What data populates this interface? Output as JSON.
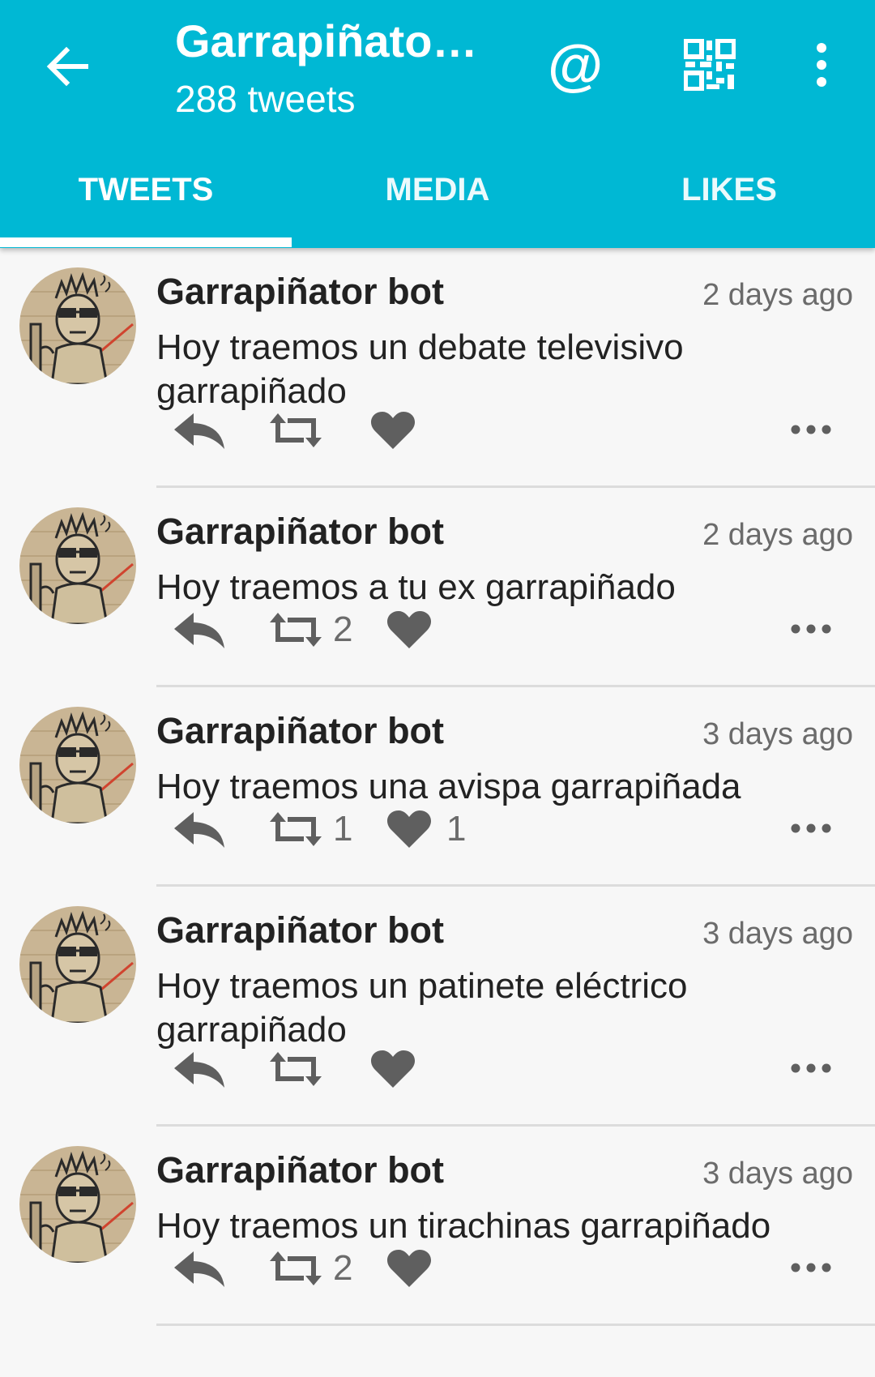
{
  "header": {
    "back_icon": "arrow-left-icon",
    "title": "Garrapiñator…",
    "subtitle": "288 tweets",
    "mention_glyph": "@",
    "qr_icon": "qr-code-icon",
    "more_icon": "vertical-dots-icon"
  },
  "tabs": [
    {
      "label": "TWEETS",
      "active": true
    },
    {
      "label": "MEDIA",
      "active": false
    },
    {
      "label": "LIKES",
      "active": false
    }
  ],
  "colors": {
    "accent": "#00b8d4",
    "background": "#f7f7f7",
    "text": "#222222",
    "muted": "#6b6b6b",
    "icon": "#5f5f5f"
  },
  "tweets": [
    {
      "author": "Garrapiñator bot",
      "time": "2 days ago",
      "text": "Hoy traemos un debate televisivo garrapiñado",
      "retweets": "",
      "likes": ""
    },
    {
      "author": "Garrapiñator bot",
      "time": "2 days ago",
      "text": "Hoy traemos a tu ex garrapiñado",
      "retweets": "2",
      "likes": ""
    },
    {
      "author": "Garrapiñator bot",
      "time": "3 days ago",
      "text": "Hoy traemos una avispa garrapiñada",
      "retweets": "1",
      "likes": "1"
    },
    {
      "author": "Garrapiñator bot",
      "time": "3 days ago",
      "text": "Hoy traemos un patinete eléctrico garrapiñado",
      "retweets": "",
      "likes": ""
    },
    {
      "author": "Garrapiñator bot",
      "time": "3 days ago",
      "text": "Hoy traemos un tirachinas garrapiñado",
      "retweets": "2",
      "likes": ""
    }
  ]
}
